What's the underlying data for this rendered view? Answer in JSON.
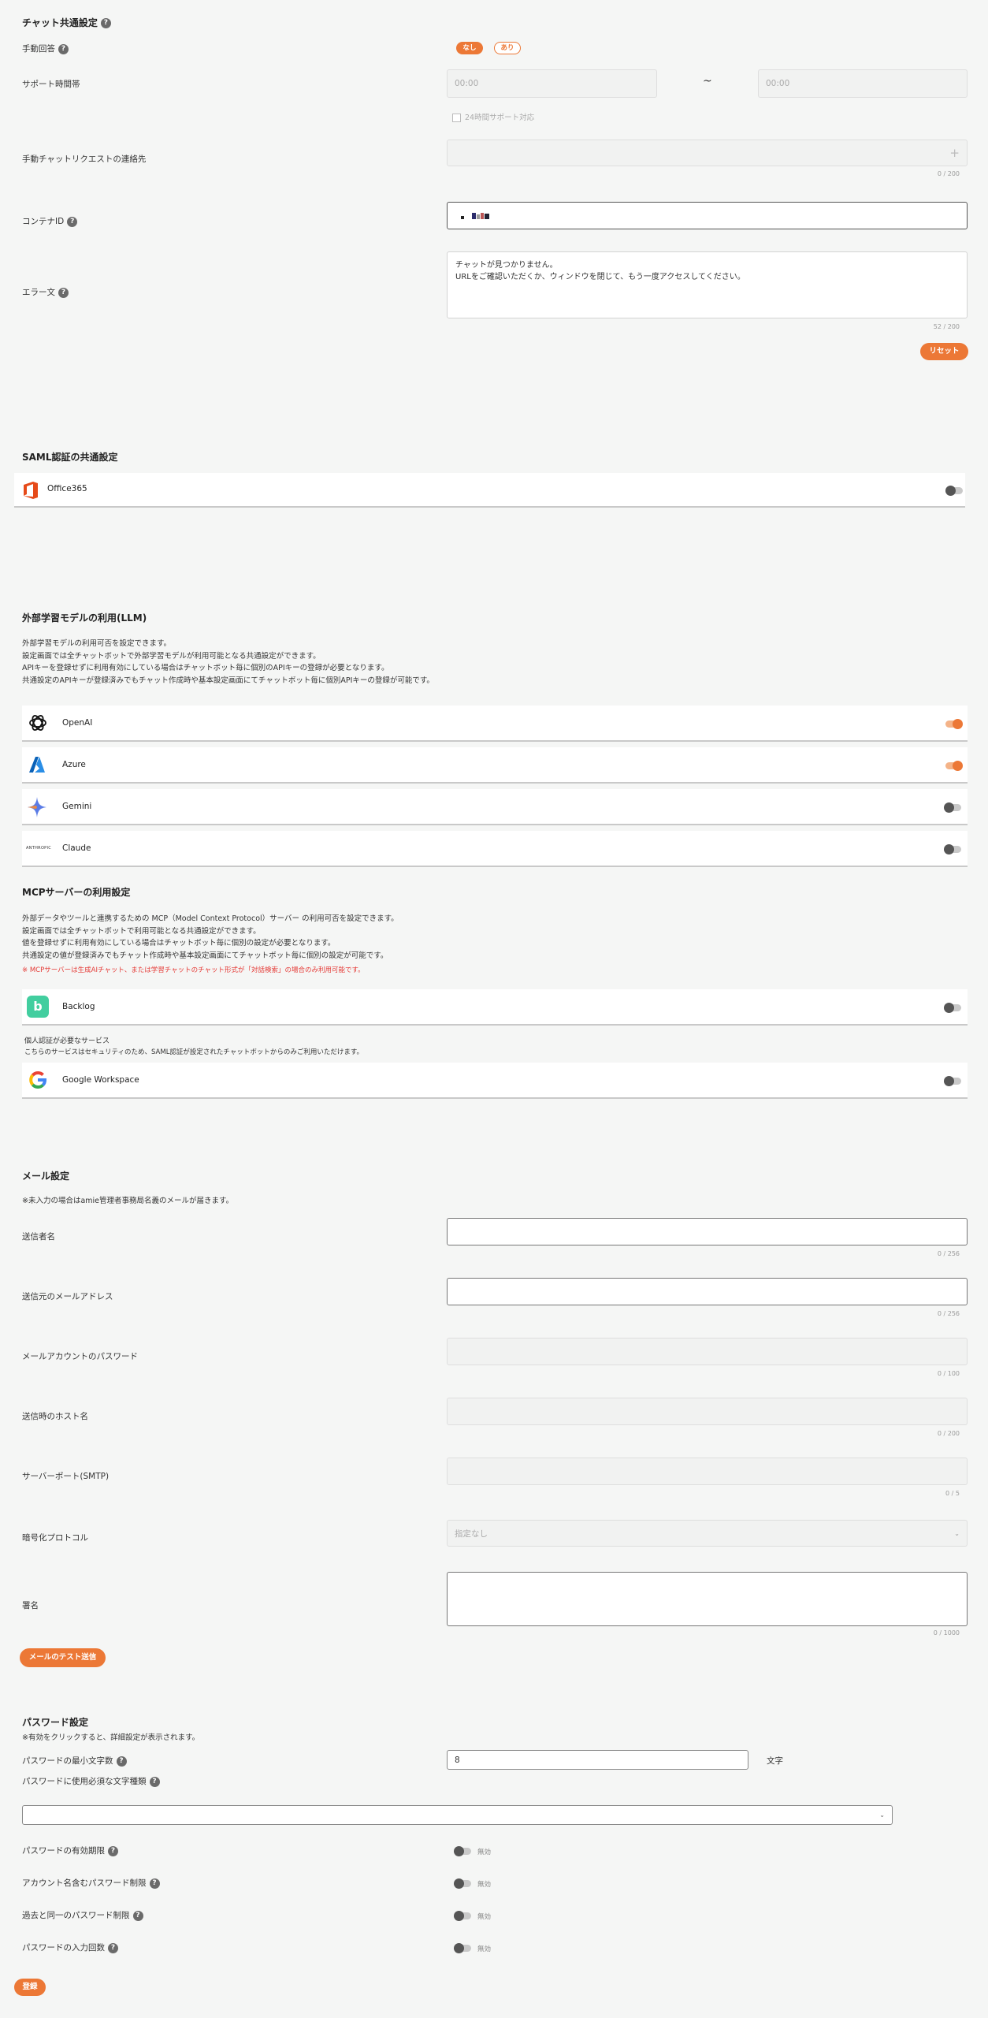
{
  "chat": {
    "title": "チャット共通設定",
    "manual_reply": {
      "label": "手動回答",
      "options": [
        "なし",
        "あり"
      ]
    },
    "support_hours": {
      "label": "サポート時間帯",
      "start_placeholder": "00:00",
      "sep": "~",
      "end_placeholder": "00:00",
      "checkbox_label": "24時間サポート対応"
    },
    "manual_request": {
      "label": "手動チャットリクエストの連絡先",
      "counter": "0 / 200",
      "add_icon": "+"
    },
    "container": {
      "label": "コンテナID"
    },
    "error_text": {
      "label": "エラー文",
      "line1": "チャットが見つかりません。",
      "line2": "URLをご確認いただくか、ウィンドウを閉じて、もう一度アクセスしてください。",
      "counter": "52 / 200"
    },
    "reset_label": "リセット"
  },
  "saml": {
    "title": "SAML認証の共通設定",
    "office": {
      "name": "Office365",
      "enabled": false
    }
  },
  "llm": {
    "title": "外部学習モデルの利用(LLM)",
    "desc": [
      "外部学習モデルの利用可否を設定できます。",
      "設定画面では全チャットボットで外部学習モデルが利用可能となる共通設定ができます。",
      "APIキーを登録せずに利用有効にしている場合はチャットボット毎に個別のAPIキーの登録が必要となります。",
      "共通設定のAPIキーが登録済みでもチャット作成時や基本設定画面にてチャットボット毎に個別APIキーの登録が可能です。"
    ],
    "items": [
      {
        "name": "OpenAI",
        "on": true
      },
      {
        "name": "Azure",
        "on": true
      },
      {
        "name": "Gemini",
        "on": false
      },
      {
        "name": "Claude",
        "on": false
      }
    ],
    "anthropic_logo_text": "ANTHROPIC"
  },
  "mcp": {
    "title": "MCPサーバーの利用設定",
    "desc": [
      "外部データやツールと連携するための MCP（Model Context Protocol）サーバー の利用可否を設定できます。",
      "設定画面では全チャットボットで利用可能となる共通設定ができます。",
      "値を登録せずに利用有効にしている場合はチャットボット毎に個別の設定が必要となります。",
      "共通設定の値が登録済みでもチャット作成時や基本設定画面にてチャットボット毎に個別の設定が可能です。"
    ],
    "note": "※ MCPサーバーは生成AIチャット、または学習チャットのチャット形式が「対話検索」の場合のみ利用可能です。",
    "backlog": {
      "name": "Backlog",
      "on": false
    },
    "auth_title": "個人認証が必要なサービス",
    "auth_desc": "こちらのサービスはセキュリティのため、SAML認証が設定されたチャットボットからのみご利用いただけます。",
    "google": {
      "name": "Google Workspace",
      "on": false
    }
  },
  "mail": {
    "title": "メール設定",
    "note": "※未入力の場合はamie管理者事務局名義のメールが届きます。",
    "sender_name": {
      "label": "送信者名",
      "counter": "0 / 256"
    },
    "sender_email": {
      "label": "送信元のメールアドレス",
      "counter": "0 / 256"
    },
    "password": {
      "label": "メールアカウントのパスワード",
      "counter": "0 / 100"
    },
    "host": {
      "label": "送信時のホスト名",
      "counter": "0 / 200"
    },
    "port": {
      "label": "サーバーポート(SMTP)",
      "counter": "0 / 5"
    },
    "protocol": {
      "label": "暗号化プロトコル",
      "value": "指定なし"
    },
    "signature": {
      "label": "署名",
      "counter": "0 / 1000"
    },
    "test_button": "メールのテスト送信"
  },
  "password_settings": {
    "title": "パスワード設定",
    "note": "※有効をクリックすると、詳細設定が表示されます。",
    "min_length": {
      "label": "パスワードの最小文字数",
      "value": "8",
      "unit": "文字"
    },
    "required_chars": {
      "label": "パスワードに使用必須な文字種類"
    },
    "toggles": [
      {
        "label": "パスワードの有効期限",
        "state": "無効"
      },
      {
        "label": "アカウント名含むパスワード制限",
        "state": "無効"
      },
      {
        "label": "過去と同一のパスワード制限",
        "state": "無効"
      },
      {
        "label": "パスワードの入力回数",
        "state": "無効"
      }
    ]
  },
  "save_label": "登録",
  "colors": {
    "accent": "#ec7836",
    "note_red": "#e53935"
  }
}
